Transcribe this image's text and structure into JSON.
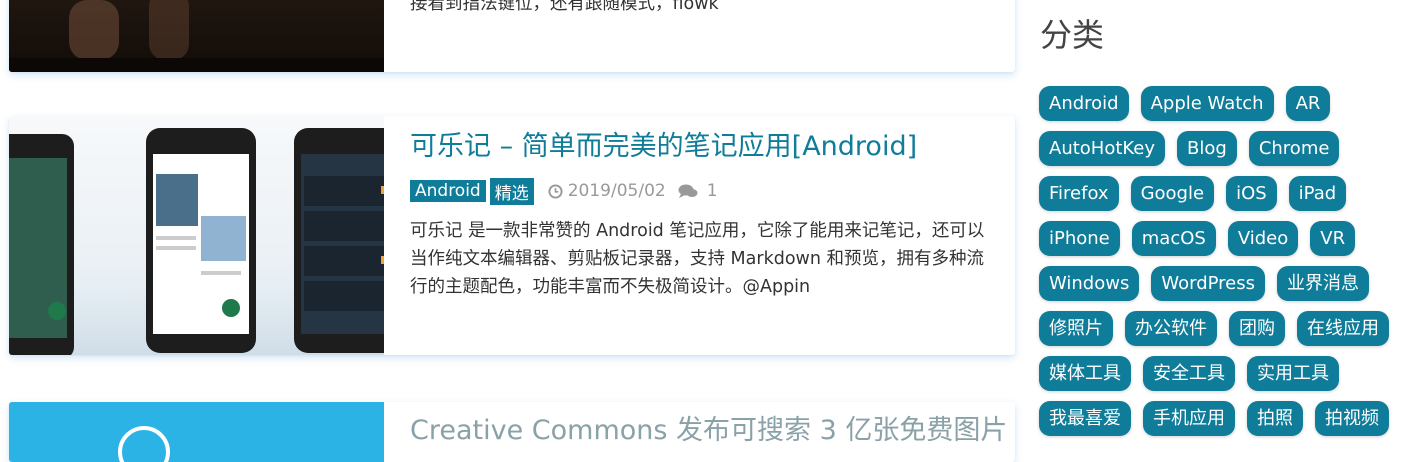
{
  "posts": [
    {
      "excerpt": "接看到指法键位，还有跟随模式，flowk"
    },
    {
      "title": "可乐记 – 简单而完美的笔记应用[Android]",
      "tags": [
        "Android",
        "精选"
      ],
      "date": "2019/05/02",
      "comments": "1",
      "excerpt": "可乐记 是一款非常赞的 Android 笔记应用，它除了能用来记笔记，还可以当作纯文本编辑器、剪贴板记录器，支持 Markdown 和预览，拥有多种流行的主题配色，功能丰富而不失极简设计。@Appin"
    },
    {
      "title": "Creative Commons 发布可搜索 3 亿张免费图片"
    }
  ],
  "sidebar": {
    "title": "分类",
    "categories": [
      "Android",
      "Apple Watch",
      "AR",
      "AutoHotKey",
      "Blog",
      "Chrome",
      "Firefox",
      "Google",
      "iOS",
      "iPad",
      "iPhone",
      "macOS",
      "Video",
      "VR",
      "Windows",
      "WordPress",
      "业界消息",
      "修照片",
      "办公软件",
      "团购",
      "在线应用",
      "媒体工具",
      "安全工具",
      "实用工具",
      "我最喜爱",
      "手机应用",
      "拍照",
      "拍视频"
    ]
  },
  "colors": {
    "accent": "#0f7c9a",
    "meta_gray": "#999999"
  },
  "icons": {
    "date": "clock-icon",
    "comments": "comments-icon"
  }
}
